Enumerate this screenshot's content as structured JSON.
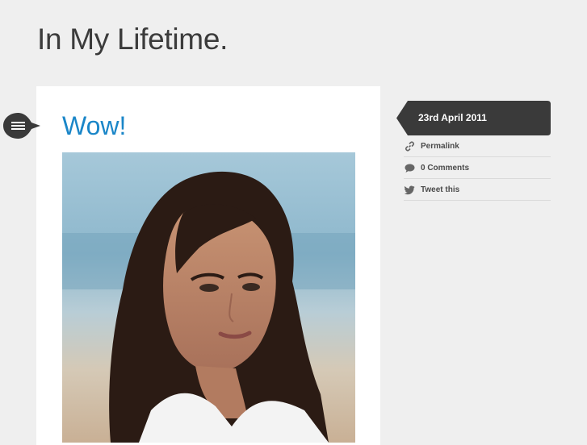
{
  "site": {
    "title": "In My Lifetime."
  },
  "post": {
    "title": "Wow!",
    "type_icon": "menu-lines-icon",
    "photo": "portrait of a woman with long dark hair in a white shirt on a beach"
  },
  "sidebar": {
    "date": "23rd April 2011",
    "links": [
      {
        "label": "Permalink",
        "icon": "link-icon"
      },
      {
        "label": "0 Comments",
        "icon": "comment-icon"
      },
      {
        "label": "Tweet this",
        "icon": "twitter-bird-icon"
      }
    ]
  },
  "colors": {
    "background": "#efefef",
    "title_link": "#1a86c8",
    "date_tab": "#3a3a3a",
    "text": "#3b3b3b"
  }
}
